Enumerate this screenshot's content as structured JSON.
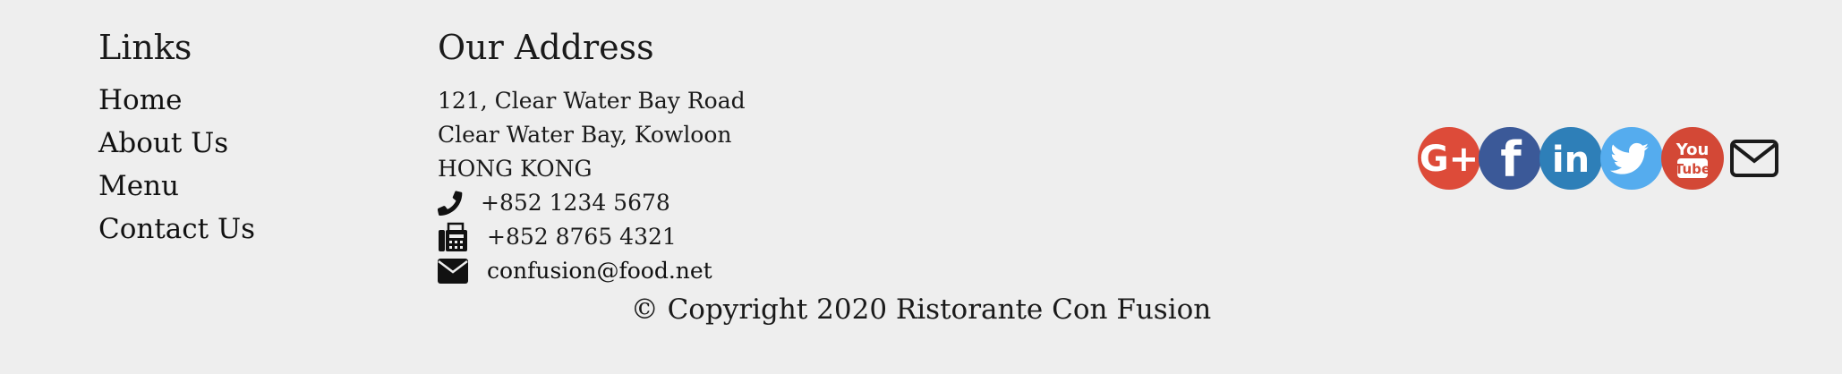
{
  "links": {
    "heading": "Links",
    "items": [
      {
        "label": "Home"
      },
      {
        "label": "About Us"
      },
      {
        "label": "Menu"
      },
      {
        "label": "Contact Us"
      }
    ]
  },
  "address": {
    "heading": "Our Address",
    "lines": [
      "121, Clear Water Bay Road",
      "Clear Water Bay, Kowloon",
      "HONG KONG"
    ],
    "phone": "+852 1234 5678",
    "fax": "+852 8765 4321",
    "email": "confusion@food.net"
  },
  "social": {
    "items": [
      {
        "name": "google-plus-icon",
        "color": "#dd4b39"
      },
      {
        "name": "facebook-icon",
        "color": "#3b5998"
      },
      {
        "name": "linkedin-icon",
        "color": "#2e7fb8"
      },
      {
        "name": "twitter-icon",
        "color": "#55acee"
      },
      {
        "name": "youtube-icon",
        "color": "#d34836"
      },
      {
        "name": "envelope-icon",
        "color": "#1a1a1a"
      }
    ],
    "google_plus_text": "G+",
    "facebook_text": "f",
    "linkedin_text": "in",
    "youtube_text_1": "You",
    "youtube_text_2": "Tube"
  },
  "copyright": "© Copyright 2020 Ristorante Con Fusion"
}
